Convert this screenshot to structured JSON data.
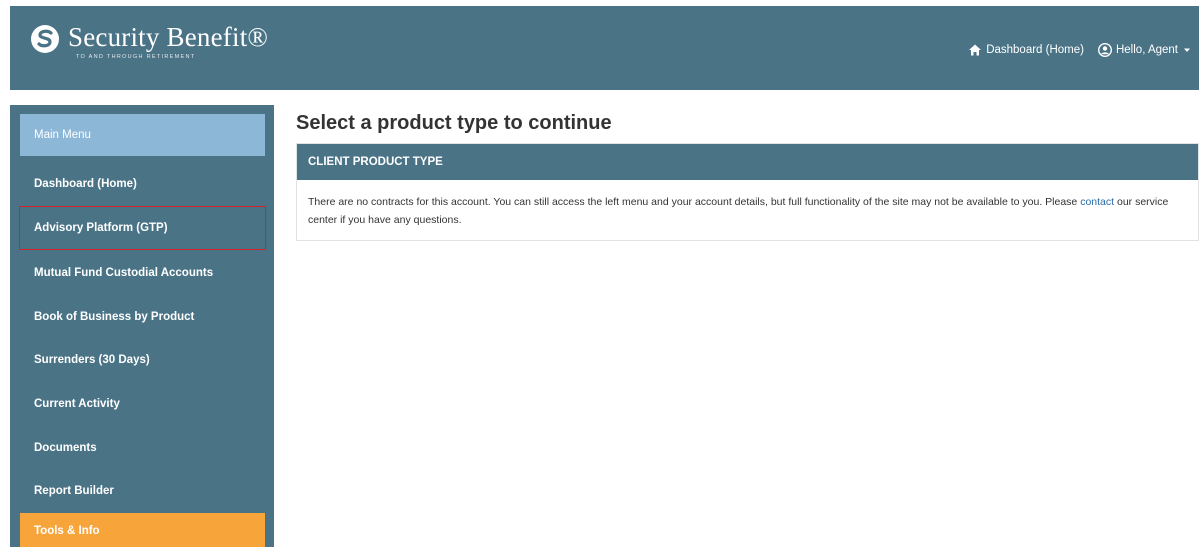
{
  "header": {
    "brand_name": "Security Benefit®",
    "tagline": "TO AND THROUGH RETIREMENT",
    "nav": {
      "dashboard_label": "Dashboard (Home)",
      "user_label": "Hello, Agent"
    }
  },
  "sidebar": {
    "items": [
      {
        "label": "Main Menu"
      },
      {
        "label": "Dashboard (Home)"
      },
      {
        "label": "Advisory Platform (GTP)"
      },
      {
        "label": "Mutual Fund Custodial Accounts"
      },
      {
        "label": "Book of Business by Product"
      },
      {
        "label": "Surrenders (30 Days)"
      },
      {
        "label": "Current Activity"
      },
      {
        "label": "Documents"
      },
      {
        "label": "Report Builder"
      },
      {
        "label": "Tools & Info"
      }
    ]
  },
  "main": {
    "title": "Select a product type to continue",
    "panel": {
      "header": "CLIENT PRODUCT TYPE",
      "message_before": "There are no contracts for this account. You can still access the left menu and your account details, but full functionality of the site may not be available to you. Please ",
      "link_text": "contact",
      "message_after": " our service center if you have any questions."
    }
  },
  "colors": {
    "brand_blue": "#4a7386",
    "main_menu_blue": "#8cb7d7",
    "tools_orange": "#f7a43b",
    "highlight_red": "#d6202a",
    "link_blue": "#2a6aa8"
  },
  "icons": [
    "security-benefit-logo-icon",
    "home-icon",
    "user-circle-icon",
    "caret-down-icon"
  ]
}
